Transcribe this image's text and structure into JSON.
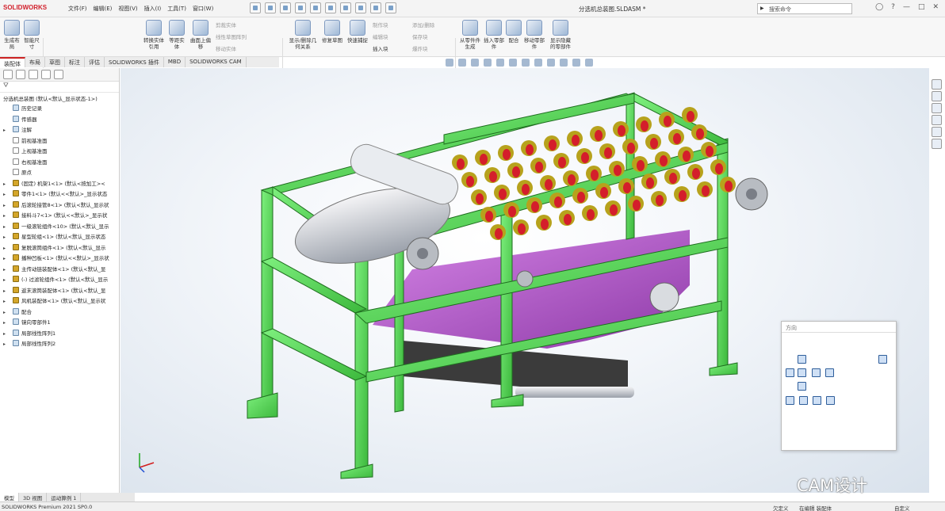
{
  "app": {
    "logo": "SOLIDWORKS",
    "doc_title": "分选机总装图.SLDASM *",
    "menus": [
      "文件(F)",
      "编辑(E)",
      "视图(V)",
      "插入(I)",
      "工具(T)",
      "窗口(W)"
    ],
    "search_placeholder": "搜索命令"
  },
  "ribbon": {
    "large": [
      "生成布局",
      "智能尺寸",
      "转换实体引用",
      "等距实体",
      "曲面上偏移",
      "显示/删除几何关系",
      "修复草图",
      "快速捕捉",
      "从零件件生成",
      "插入零部件",
      "配合",
      "移动零部件",
      "显示隐藏的零部件"
    ],
    "small": [
      "剪裁实体",
      "线性草图阵列",
      "移动实体",
      "制作块",
      "编辑块",
      "插入块",
      "添加/删除",
      "保存块",
      "爆炸块"
    ]
  },
  "tabs": [
    "装配体",
    "布局",
    "草图",
    "标注",
    "评估",
    "SOLIDWORKS 插件",
    "MBD",
    "SOLIDWORKS CAM"
  ],
  "tree": {
    "root": "分选机总装图 (默认<默认_显示状态-1>)",
    "items": [
      {
        "label": "历史记录",
        "kind": "hist",
        "tw": ""
      },
      {
        "label": "传感器",
        "kind": "hist",
        "tw": ""
      },
      {
        "label": "注解",
        "kind": "hist",
        "tw": "▸"
      },
      {
        "label": "前视基准面",
        "kind": "plane",
        "tw": ""
      },
      {
        "label": "上视基准面",
        "kind": "plane",
        "tw": ""
      },
      {
        "label": "右视基准面",
        "kind": "plane",
        "tw": ""
      },
      {
        "label": "原点",
        "kind": "plane",
        "tw": ""
      },
      {
        "label": "(固定) 机架1<1> (默认<按加工><",
        "kind": "part",
        "tw": "▸"
      },
      {
        "label": "零件1<1> (默认<<默认>_显示状态",
        "kind": "part",
        "tw": "▸"
      },
      {
        "label": "后滚轮接管8<1> (默认<默认_显示状",
        "kind": "part",
        "tw": "▸"
      },
      {
        "label": "接料斗7<1> (默认<<默认>_显示状",
        "kind": "part",
        "tw": "▸"
      },
      {
        "label": "一级滚轮组件<10> (默认<默认_显示",
        "kind": "part",
        "tw": "▸"
      },
      {
        "label": "星型轮组<1> (默认<默认_显示状态",
        "kind": "part",
        "tw": "▸"
      },
      {
        "label": "复脱滚筒组件<1> (默认<默认_显示",
        "kind": "part",
        "tw": "▸"
      },
      {
        "label": "播种凹板<1> (默认<<默认>_显示状",
        "kind": "part",
        "tw": "▸"
      },
      {
        "label": "主传动链装配体<1> (默认<默认_显",
        "kind": "part",
        "tw": "▸"
      },
      {
        "label": "(-) 过滤轮组件<1> (默认<默认_显示",
        "kind": "part",
        "tw": "▸"
      },
      {
        "label": "返末滚筒装配体<1> (默认<默认_显",
        "kind": "part",
        "tw": "▸"
      },
      {
        "label": "风机装配体<1> (默认<默认_显示状",
        "kind": "part",
        "tw": "▸"
      },
      {
        "label": "配合",
        "kind": "hist",
        "tw": "▸"
      },
      {
        "label": "镜向零部件1",
        "kind": "hist",
        "tw": "▸"
      },
      {
        "label": "局部线性阵列1",
        "kind": "hist",
        "tw": "▸"
      },
      {
        "label": "局部线性阵列2",
        "kind": "hist",
        "tw": "▸"
      }
    ]
  },
  "bottom_tabs": [
    "模型",
    "3D 视图",
    "运动算例 1"
  ],
  "status": {
    "left": "SOLIDWORKS Premium 2021 SP0.0",
    "s1": "欠定义",
    "s2": "在编辑 装配体",
    "s3": "自定义"
  },
  "orientation": {
    "title": "方向"
  },
  "watermark": "CAM设计",
  "colors": {
    "frame": "#5ed45e",
    "hopper": "#b05ac4",
    "accent": "#c22"
  }
}
